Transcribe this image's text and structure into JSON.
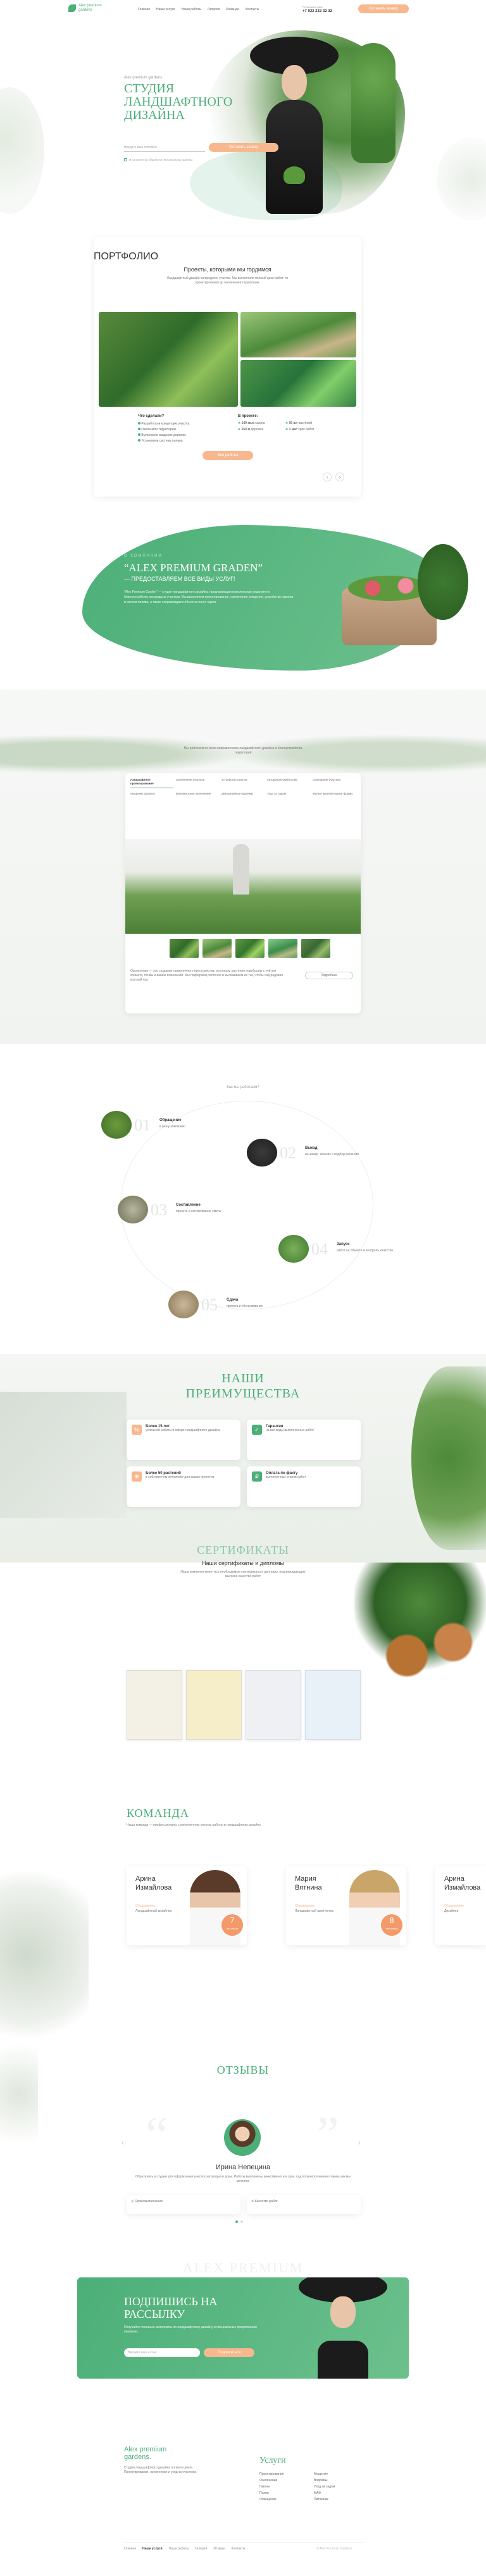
{
  "header": {
    "logo_line1": "Alex premium",
    "logo_line2": "gardens",
    "nav": [
      "Главная",
      "Наши услуги",
      "Наши работы",
      "Галерея",
      "Команда",
      "Контакты"
    ],
    "phone_label": "Позвоните нам",
    "phone": "+7 922 232 32 32",
    "cta": "Оставить заявку"
  },
  "hero": {
    "eyebrow": "Alex premium gardens",
    "title_line1": "СТУДИЯ",
    "title_line2": "ЛАНДШАФТНОГО",
    "title_line3": "ДИЗАЙНА",
    "input_placeholder": "Введите ваш телефон",
    "submit": "Оставить заявку",
    "agree": "Я согласен на обработку персональных данных"
  },
  "portfolio": {
    "title": "ПОРТФОЛИО",
    "subtitle": "Проекты, которыми мы гордимся",
    "desc": "Ландшафтный дизайн загородного участка. Мы выполнили полный цикл работ: от проектирования до озеленения территории.",
    "left_heading": "Что сделали?",
    "left_items": [
      "Разработали концепцию участка",
      "Озеленили территорию",
      "Выполнили мощение дорожек",
      "Установили систему полива"
    ],
    "right_heading": "В проекте:",
    "right_items": [
      {
        "value": "140 кв.м",
        "label": "газона"
      },
      {
        "value": "60 шт",
        "label": "растений"
      },
      {
        "value": "350 м",
        "label": "дорожек"
      },
      {
        "value": "3 мес",
        "label": "срок работ"
      }
    ],
    "more_button": "Все работы",
    "prev": "‹",
    "next": "›"
  },
  "about": {
    "eyebrow": "О КОМПАНИИ",
    "title": "“ALEX PREMIUM GRADEN”",
    "subtitle": "— ПРЕДОСТАВЛЯЕМ ВСЕ ВИДЫ УСЛУГ!",
    "text": "“Alex Premium Garden” — студия ландшафтного дизайна, предлагающая комплексные решения по благоустройству загородных участков. Мы выполняем проектирование, озеленение, мощение, устройство газонов и систем полива, а также сопровождаем объекты после сдачи."
  },
  "services": {
    "intro": "Мы работаем по всем направлениям ландшафтного дизайна и благоустройства территорий",
    "tabs": [
      "Ландшафтное проектирование",
      "Озеленение участков",
      "Устройство газонов",
      "Автоматический полив",
      "Освещение участков",
      "Мощение дорожек",
      "Вертикальное озеленение",
      "Декоративные водоёмы",
      "Уход за садом",
      "Малые архитектурные формы"
    ],
    "caption": "Озеленение — это создание гармоничного пространства, в котором растения подобраны с учётом климата, почвы и ваших пожеланий. Мы подбираем растения и высаживаем их так, чтобы сад радовал круглый год.",
    "more_button": "Подробнее"
  },
  "process": {
    "title": "Как мы работаем?",
    "steps": [
      {
        "num": "01",
        "title": "Обращение",
        "text": "в нашу компанию"
      },
      {
        "num": "02",
        "title": "Выезд",
        "text": "на замер. Анализ и подбор решения"
      },
      {
        "num": "03",
        "title": "Составление",
        "text": "проекта и согласование сметы"
      },
      {
        "num": "04",
        "title": "Запуск",
        "text": "работ на объекте и контроль качества"
      },
      {
        "num": "05",
        "title": "Сдача",
        "text": "проекта и обслуживание"
      }
    ]
  },
  "advantages": {
    "title_line1": "НАШИ",
    "title_line2": "ПРЕИМУЩЕСТВА",
    "items": [
      {
        "title": "Более 15 лет",
        "text": "успешной работы в сфере ландшафтного дизайна"
      },
      {
        "title": "Гарантия",
        "text": "на все виды выполненных работ"
      },
      {
        "title": "Более 50 растений",
        "text": "в собственном питомнике для ваших проектов"
      },
      {
        "title": "Оплата по факту",
        "text": "выполненных этапов работ"
      }
    ]
  },
  "certificates": {
    "title": "СЕРТИФИКАТЫ",
    "subtitle": "Наши сертификаты и дипломы",
    "desc": "Наша компания имеет все необходимые сертификаты и дипломы, подтверждающие высокое качество работ"
  },
  "team": {
    "title": "КОМАНДА",
    "intro": "Наша команда — профессионалы с многолетним опытом работы в ландшафтном дизайне.",
    "members": [
      {
        "first": "Арина",
        "last": "Измайлова",
        "role_label": "Образование:",
        "role": "Ландшафтный дизайнер",
        "years": "7",
        "years_label": "лет опыта"
      },
      {
        "first": "Мария",
        "last": "Вятнина",
        "role_label": "Образование:",
        "role": "Ландшафтный архитектор",
        "years": "8",
        "years_label": "лет опыта"
      },
      {
        "first": "Арина",
        "last": "Измайлова",
        "role_label": "Образование:",
        "role": "Дизайнер",
        "years": "",
        "years_label": ""
      }
    ]
  },
  "reviews": {
    "title": "ОТЗЫВЫ",
    "name": "Ирина Непецина",
    "text": "Обратились в студию для оформления участка загородного дома. Работы выполнены качественно и в срок, сад получился именно таким, как мы мечтали.",
    "labels": [
      "Сроки выполнения",
      "Качество работ"
    ],
    "prev": "‹",
    "next": "›"
  },
  "subscribe": {
    "ghost": "ALEX PREMIUM",
    "title_line1": "ПОДПИШИСЬ НА",
    "title_line2": "РАССЫЛКУ",
    "text": "Получайте полезные материалы по ландшафтному дизайну и специальные предложения первыми.",
    "input_placeholder": "Введите ваш e-mail",
    "submit": "Подписаться"
  },
  "footer": {
    "logo_line1": "Alex premium",
    "logo_line2": "gardens.",
    "about": "Студия ландшафтного дизайна полного цикла. Проектирование, озеленение и уход за участком.",
    "services_title": "Услуги",
    "col1": [
      "Проектирование",
      "Озеленение",
      "Газоны",
      "Полив",
      "Освещение"
    ],
    "col2": [
      "Мощение",
      "Водоёмы",
      "Уход за садом",
      "МАФ",
      "Питомник"
    ],
    "bottom_nav": [
      "Главная",
      "Наши услуги",
      "Наши работы",
      "Галерея",
      "Отзывы",
      "Контакты"
    ],
    "copyright": "© Alex Premium Gardens"
  }
}
